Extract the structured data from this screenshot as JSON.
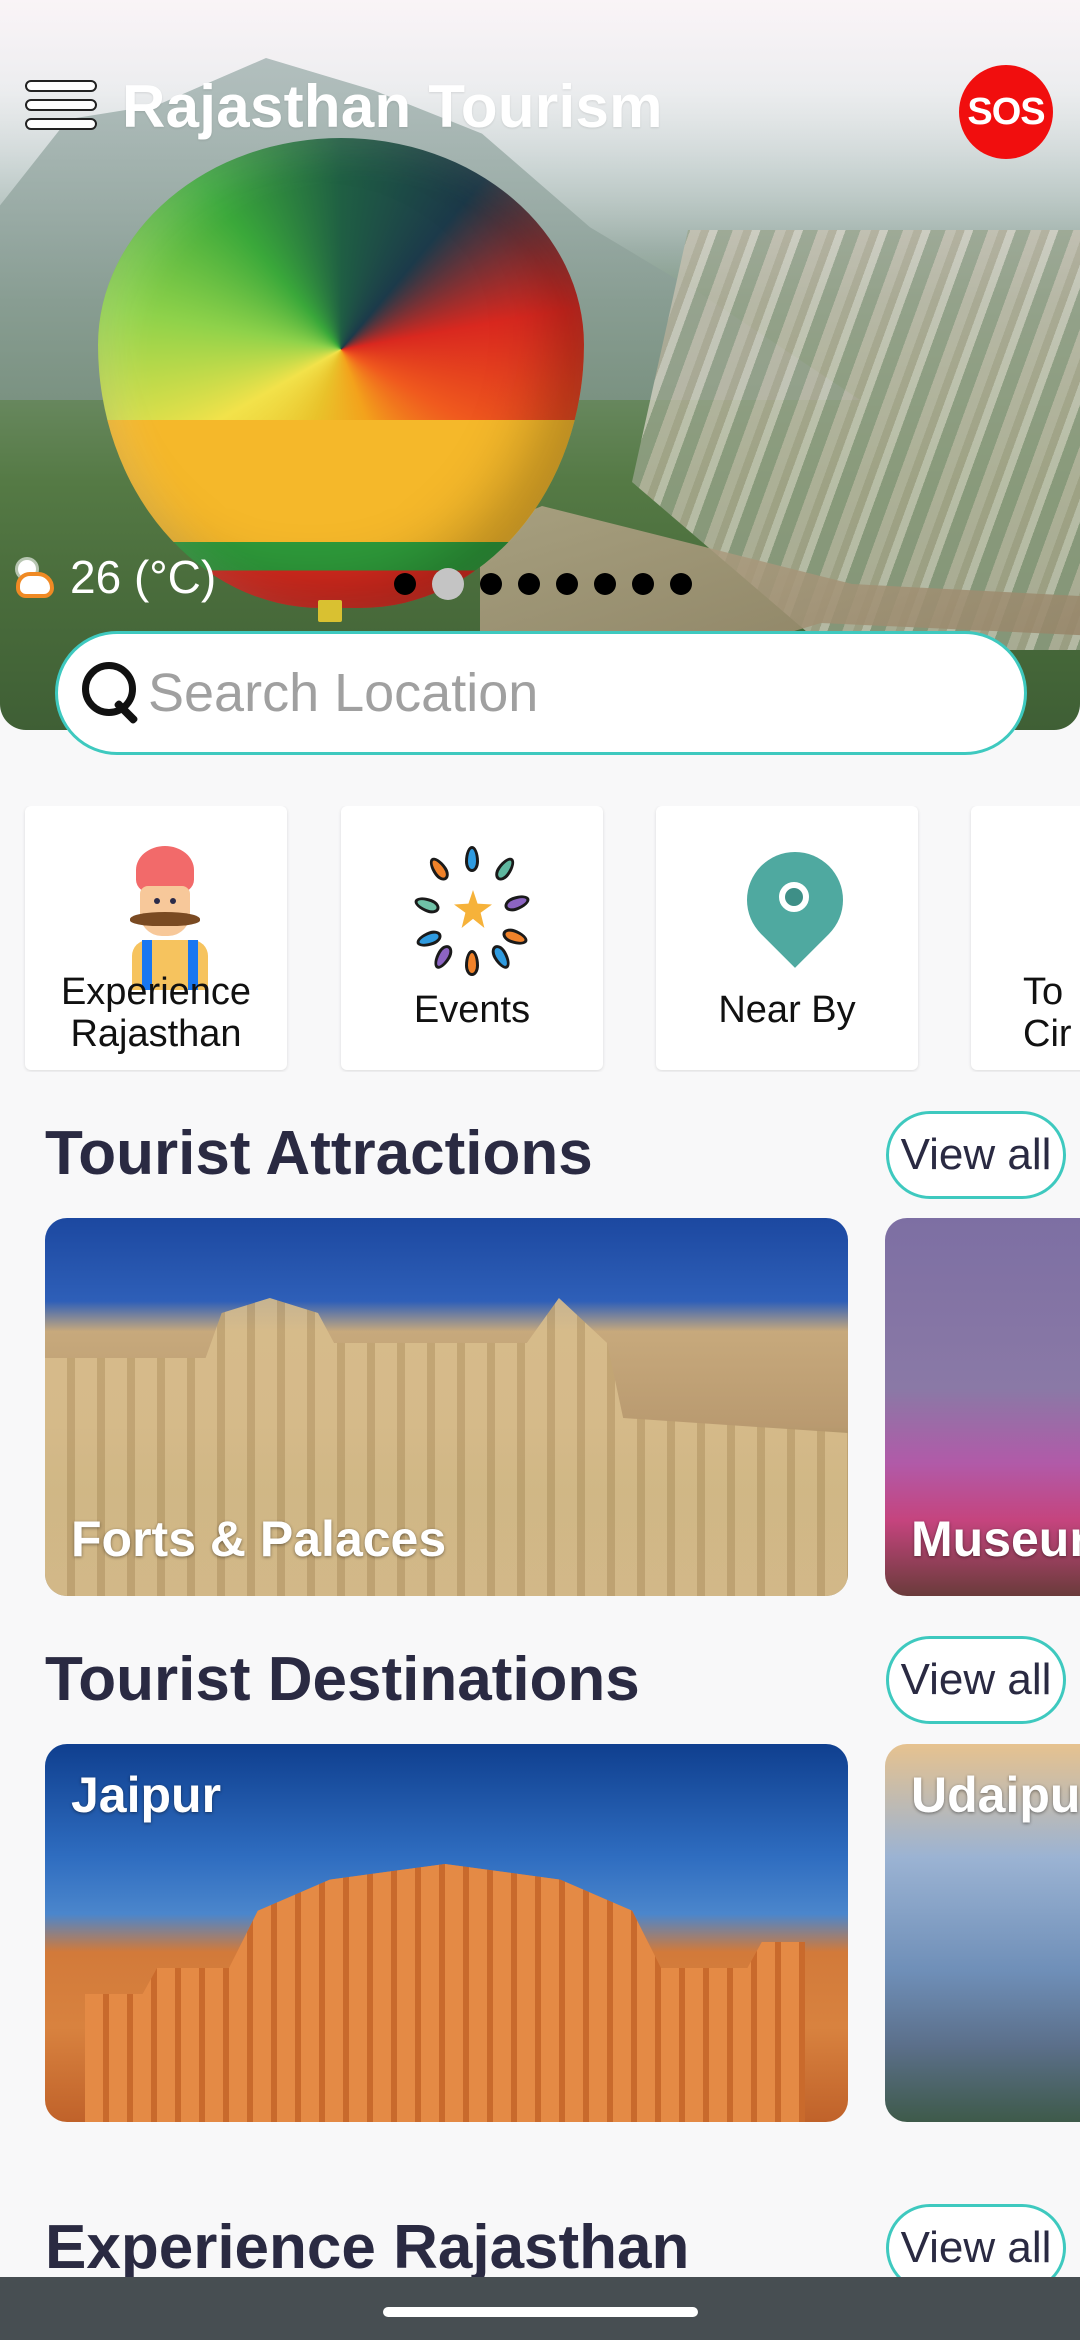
{
  "header": {
    "title": "Rajasthan Tourism",
    "menu_icon": "hamburger-menu-icon",
    "sos_label": "SOS",
    "sos_color": "#f10e0e"
  },
  "hero": {
    "weather_icon": "partly-cloudy-icon",
    "temperature": "26 (°C)",
    "carousel": {
      "total_slides": 8,
      "active_index": 1
    }
  },
  "search": {
    "icon": "search-icon",
    "placeholder": "Search Location",
    "value": "",
    "border_color": "#3ec9bf"
  },
  "categories": [
    {
      "label": "Experience Rajasthan",
      "lines": [
        "Experience",
        "Rajasthan"
      ],
      "icon": "rajasthani-man-icon"
    },
    {
      "label": "Events",
      "lines": [
        "Events"
      ],
      "icon": "fireworks-icon"
    },
    {
      "label": "Near By",
      "lines": [
        "Near By"
      ],
      "icon": "location-pin-icon"
    },
    {
      "label": "To Cir",
      "lines": [
        "To",
        "Cir"
      ],
      "icon": "circuit-icon"
    }
  ],
  "sections": [
    {
      "title": "Tourist Attractions",
      "view_all": "View all",
      "cards": [
        {
          "title": "Forts & Palaces"
        },
        {
          "title": "Museur"
        }
      ]
    },
    {
      "title": "Tourist Destinations",
      "view_all": "View all",
      "cards": [
        {
          "title": "Jaipur"
        },
        {
          "title": "Udaipu"
        }
      ]
    },
    {
      "title": "Experience Rajasthan",
      "view_all": "View all"
    }
  ],
  "theme": {
    "accent": "#3ec9bf",
    "heading_color": "#2a2a42",
    "background": "#f8f8f9",
    "navbar": "#474e52"
  }
}
